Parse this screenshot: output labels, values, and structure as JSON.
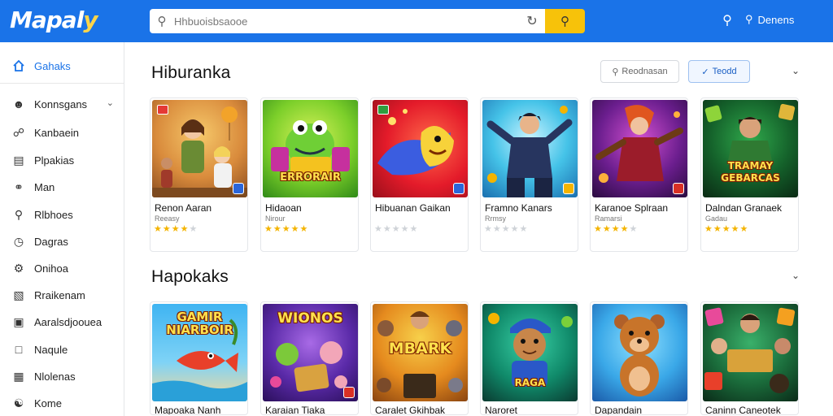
{
  "app": {
    "logo_main": "Mapal",
    "logo_accent": "y"
  },
  "search": {
    "placeholder": "Hhbuoisbsaooe"
  },
  "header": {
    "login_label": "Denens"
  },
  "sidebar": {
    "items": [
      {
        "label": "Gahaks",
        "icon": "home-icon"
      },
      {
        "label": "Konnsgans",
        "icon": "person-icon"
      },
      {
        "label": "Kanbaein",
        "icon": "link-icon"
      },
      {
        "label": "Plpakias",
        "icon": "document-icon"
      },
      {
        "label": "Man",
        "icon": "compass-icon"
      },
      {
        "label": "Rlbhoes",
        "icon": "search-icon"
      },
      {
        "label": "Dagras",
        "icon": "clock-icon"
      },
      {
        "label": "Onihoa",
        "icon": "gear-icon"
      },
      {
        "label": "Rraikenam",
        "icon": "chart-icon"
      },
      {
        "label": "Aaralsdjoouea",
        "icon": "card-icon"
      },
      {
        "label": "Naqule",
        "icon": "bookmark-icon"
      },
      {
        "label": "Nlolenas",
        "icon": "calendar-icon"
      },
      {
        "label": "Kome",
        "icon": "globe-icon"
      }
    ]
  },
  "section1": {
    "title": "Hiburanka",
    "filter_a": "Reodnasan",
    "filter_b": "Teodd",
    "cards": [
      {
        "name": "Renon Aaran",
        "sub": "Reeasy",
        "rating": 4
      },
      {
        "name": "Hidaoan",
        "sub": "Nirour",
        "rating": 5
      },
      {
        "name": "Hibuanan Gaikan",
        "sub": "",
        "rating": 0
      },
      {
        "name": "Framno Kanars",
        "sub": "Rrmsy",
        "rating": 0
      },
      {
        "name": "Karanoe Splraan",
        "sub": "Ramarsi",
        "rating": 4
      },
      {
        "name": "Dalndan Granaek",
        "sub": "Gadau",
        "rating": 5
      }
    ]
  },
  "section2": {
    "title": "Hapokaks",
    "cards": [
      {
        "name": "Mapoaka Nanh",
        "art": "GAMIR NIARBOIR"
      },
      {
        "name": "Karaian Tiaka",
        "art": "WIONOS"
      },
      {
        "name": "Caralet Gkihbak",
        "art": "MBARK"
      },
      {
        "name": "Naroret",
        "art": "RAGA"
      },
      {
        "name": "Dapandain",
        "art": ""
      },
      {
        "name": "Caninn Caneotek",
        "art": ""
      }
    ]
  },
  "art": {
    "s1c2_text": "ERRORAIR",
    "s1c6_text": "TRAMAY GEBARCAS"
  },
  "colors": {
    "brand": "#1a73e8",
    "search_button": "#f7c20a",
    "star": "#f4b400"
  }
}
